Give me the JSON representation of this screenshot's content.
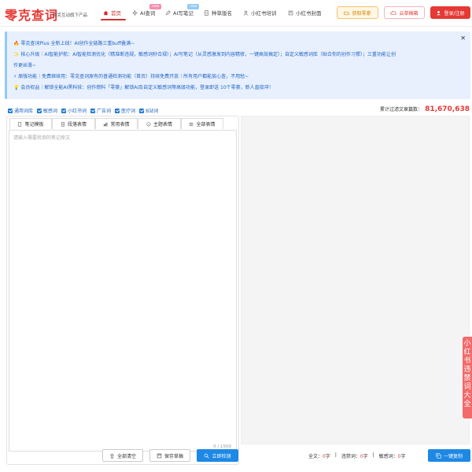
{
  "header": {
    "logo": "零克查词",
    "logo_sub": "零克互动旗下产品",
    "nav": [
      {
        "label": "首页",
        "icon": "home-icon",
        "active": true
      },
      {
        "label": "AI查词",
        "icon": "sparkle-icon",
        "badge": "new"
      },
      {
        "label": "AI写笔记",
        "icon": "pen-icon",
        "badge": "new"
      },
      {
        "label": "种草版名",
        "icon": "bookmark-icon"
      },
      {
        "label": "小红书培训",
        "icon": "user-icon"
      },
      {
        "label": "小红书封面",
        "icon": "picture-icon"
      }
    ],
    "btn_points": "获取零豪",
    "btn_drafts": "云草稿箱",
    "btn_login": "登录/注册"
  },
  "notice": {
    "lines": [
      "🔥 零克查词Plus 全新上线！AI创作全链路三重buff叠满~",
      "✨ 核心升级｜AI智能护航：AI智能检测优化（精准断违规，敏感词秒合规）；AI写笔记（从灵感激发到内容精修，一键高效搞定）；自定义敏感词库（贴合你的创作习惯）；三重功能让创",
      "作更丝滑~",
      "⚡ 原版功能｜免费继续用：零克查词原有的普通检测功能（首页）持续免费开放｜所有用户都能放心查，不用愁~",
      "💡 会员权益｜解锁全能AI黑科技：创作燃料「零豪」解锁AI及自定义敏感词等高级功能，登录即送 10个零豪，新人直接冲！"
    ],
    "close": "✕"
  },
  "options": [
    {
      "label": "通用词库",
      "checked": true
    },
    {
      "label": "敏感词",
      "checked": true
    },
    {
      "label": "小红书词",
      "checked": true
    },
    {
      "label": "广告词",
      "checked": true
    },
    {
      "label": "医疗词",
      "checked": true
    },
    {
      "label": "B站词",
      "checked": true
    }
  ],
  "total": {
    "label": "累计过滤文章篇数：",
    "value": "81,670,638"
  },
  "tabs": [
    {
      "label": "笔记模板",
      "icon": "doc-icon"
    },
    {
      "label": "段落表情",
      "icon": "file-icon"
    },
    {
      "label": "常用表情",
      "icon": "chart-icon"
    },
    {
      "label": "主题表情",
      "icon": "smile-icon"
    },
    {
      "label": "全部表情",
      "icon": "list-icon"
    }
  ],
  "editor": {
    "placeholder": "请输入需要检测的笔记原文",
    "counter": "0 / 1500"
  },
  "actions": {
    "clear": "全部清空",
    "save": "保存草稿",
    "check": "立即检测"
  },
  "stats": {
    "total_label": "全文：",
    "total_value": "0",
    "total_unit": "字",
    "banned_label": "违禁词：",
    "banned_value": "0",
    "banned_unit": "字",
    "sensitive_label": "敏感词：",
    "sensitive_value": "0",
    "sensitive_unit": "字",
    "copy": "一键复制"
  },
  "side_float": "小红书违禁词大全",
  "colors": {
    "brand_red": "#e53935",
    "link_blue": "#1e63c3",
    "primary_blue": "#1e88e5",
    "notice_bg": "#e8f0fe"
  }
}
